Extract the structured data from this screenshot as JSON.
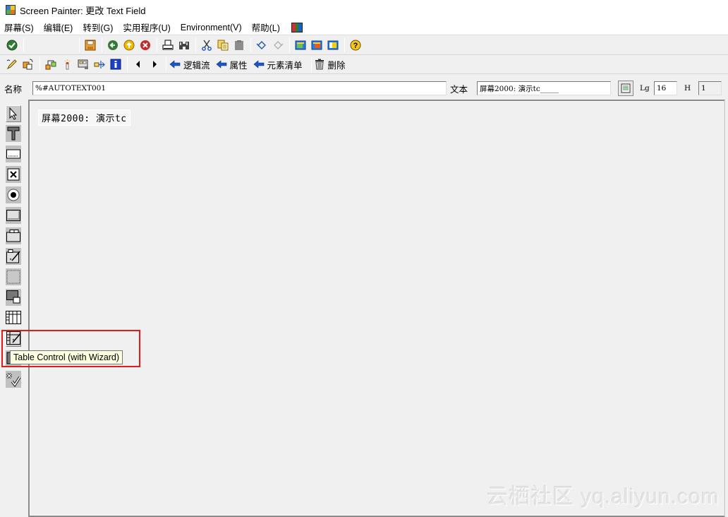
{
  "window": {
    "title": "Screen Painter:  更改 Text Field"
  },
  "menu": [
    {
      "label": "屏幕(S)"
    },
    {
      "label": "编辑(E)"
    },
    {
      "label": "转到(G)"
    },
    {
      "label": "实用程序(U)"
    },
    {
      "label": "Environment(V)"
    },
    {
      "label": "帮助(L)"
    }
  ],
  "menu_extra_icon": "color-palette-icon",
  "toolbar1": {
    "icons": [
      "enter-icon",
      "save-icon",
      "back-icon",
      "exit-icon",
      "cancel-icon",
      "print-icon",
      "find-icon",
      "cut-icon",
      "copy-icon",
      "paste-icon",
      "undo-icon",
      "redo-icon",
      "layout-icon-1",
      "layout-icon-2",
      "layout-icon-3",
      "help-icon"
    ]
  },
  "toolbar2": {
    "icons": [
      "edit-pencil-icon",
      "copy-element-icon",
      "hierarchy-icon",
      "insert-icon",
      "screen-element-icon",
      "move-element-icon",
      "info-icon",
      "previous-icon",
      "next-icon"
    ],
    "buttons": [
      {
        "label": "逻辑流"
      },
      {
        "label": "属性"
      },
      {
        "label": "元素清单"
      },
      {
        "label": "删除"
      }
    ]
  },
  "fields": {
    "name_label": "名称",
    "name_value": "%#AUTOTEXT001",
    "text_label": "文本",
    "text_value": "屏幕2000: 演示tc_____",
    "lg_label": "Lg",
    "lg_value": "16",
    "h_label": "H",
    "h_value": "1"
  },
  "palette": [
    {
      "name": "select-pointer-icon",
      "tooltip": ""
    },
    {
      "name": "text-field-icon"
    },
    {
      "name": "input-output-field-icon"
    },
    {
      "name": "checkbox-icon"
    },
    {
      "name": "radio-button-icon"
    },
    {
      "name": "pushbutton-icon"
    },
    {
      "name": "tabstrip-control-icon"
    },
    {
      "name": "tabstrip-wizard-icon"
    },
    {
      "name": "box-icon"
    },
    {
      "name": "subscreen-area-icon"
    },
    {
      "name": "table-control-icon"
    },
    {
      "name": "table-control-wizard-icon"
    },
    {
      "name": "custom-control-icon"
    },
    {
      "name": "status-icon"
    }
  ],
  "canvas": {
    "text_element": "屏幕2000: 演示tc"
  },
  "tooltip": {
    "text": "Table Control (with Wizard)"
  },
  "watermark": "云栖社区 yq.aliyun.com"
}
